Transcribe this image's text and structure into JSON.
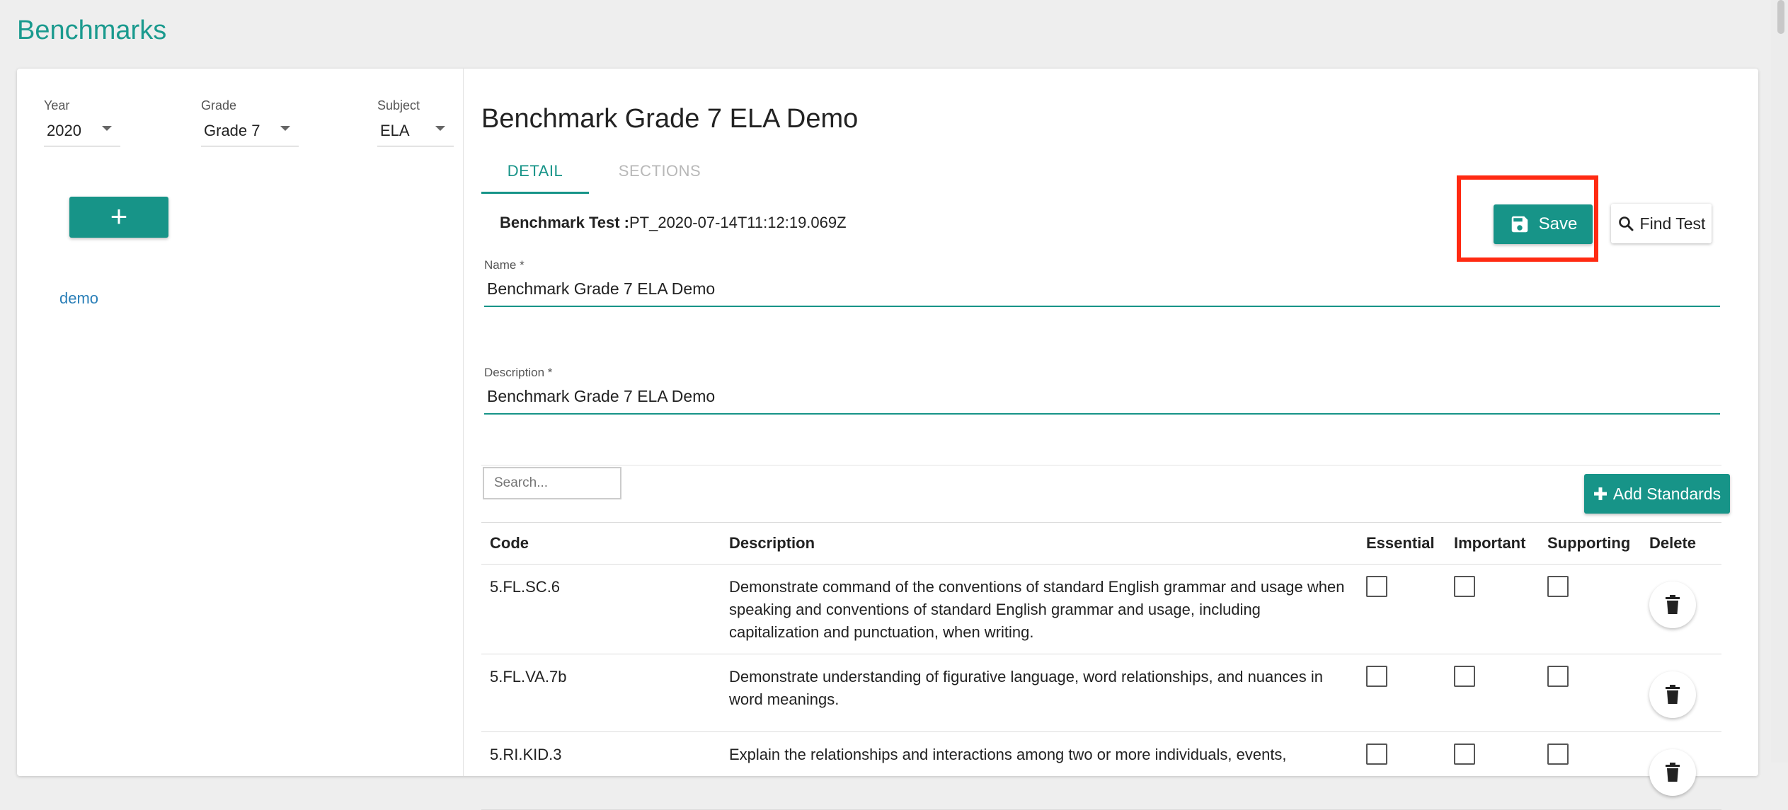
{
  "page": {
    "title": "Benchmarks"
  },
  "filters": {
    "year": {
      "label": "Year",
      "value": "2020"
    },
    "grade": {
      "label": "Grade",
      "value": "Grade 7"
    },
    "subject": {
      "label": "Subject",
      "value": "ELA"
    }
  },
  "sidebar": {
    "add_label": "+",
    "items": [
      {
        "label": "demo"
      }
    ]
  },
  "detail": {
    "title": "Benchmark Grade 7 ELA Demo",
    "tabs": [
      {
        "label": "DETAIL",
        "active": true
      },
      {
        "label": "SECTIONS",
        "active": false
      }
    ],
    "test_label": "Benchmark Test :",
    "test_value": "PT_2020-07-14T11:12:19.069Z",
    "save_label": "Save",
    "find_label": "Find Test",
    "name_label": "Name *",
    "name_value": "Benchmark Grade 7 ELA Demo",
    "description_label": "Description *",
    "description_value": "Benchmark Grade 7 ELA Demo",
    "search_placeholder": "Search...",
    "add_standards_label": "Add Standards"
  },
  "table": {
    "headers": [
      "Code",
      "Description",
      "Essential",
      "Important",
      "Supporting",
      "Delete"
    ],
    "rows": [
      {
        "code": "5.FL.SC.6",
        "description": "Demonstrate command of the conventions of standard English grammar and usage when speaking and conventions of standard English grammar and usage, including capitalization and punctuation, when writing.",
        "essential": false,
        "important": false,
        "supporting": false
      },
      {
        "code": "5.FL.VA.7b",
        "description": "Demonstrate understanding of figurative language, word relationships, and nuances in word meanings.",
        "essential": false,
        "important": false,
        "supporting": false
      },
      {
        "code": "5.RI.KID.3",
        "description": "Explain the relationships and interactions among two or more individuals, events,",
        "essential": false,
        "important": false,
        "supporting": false
      }
    ]
  },
  "colors": {
    "accent": "#179488",
    "title": "#1a9a8e",
    "link": "#2a7fb8",
    "highlight": "#ff2a12"
  }
}
